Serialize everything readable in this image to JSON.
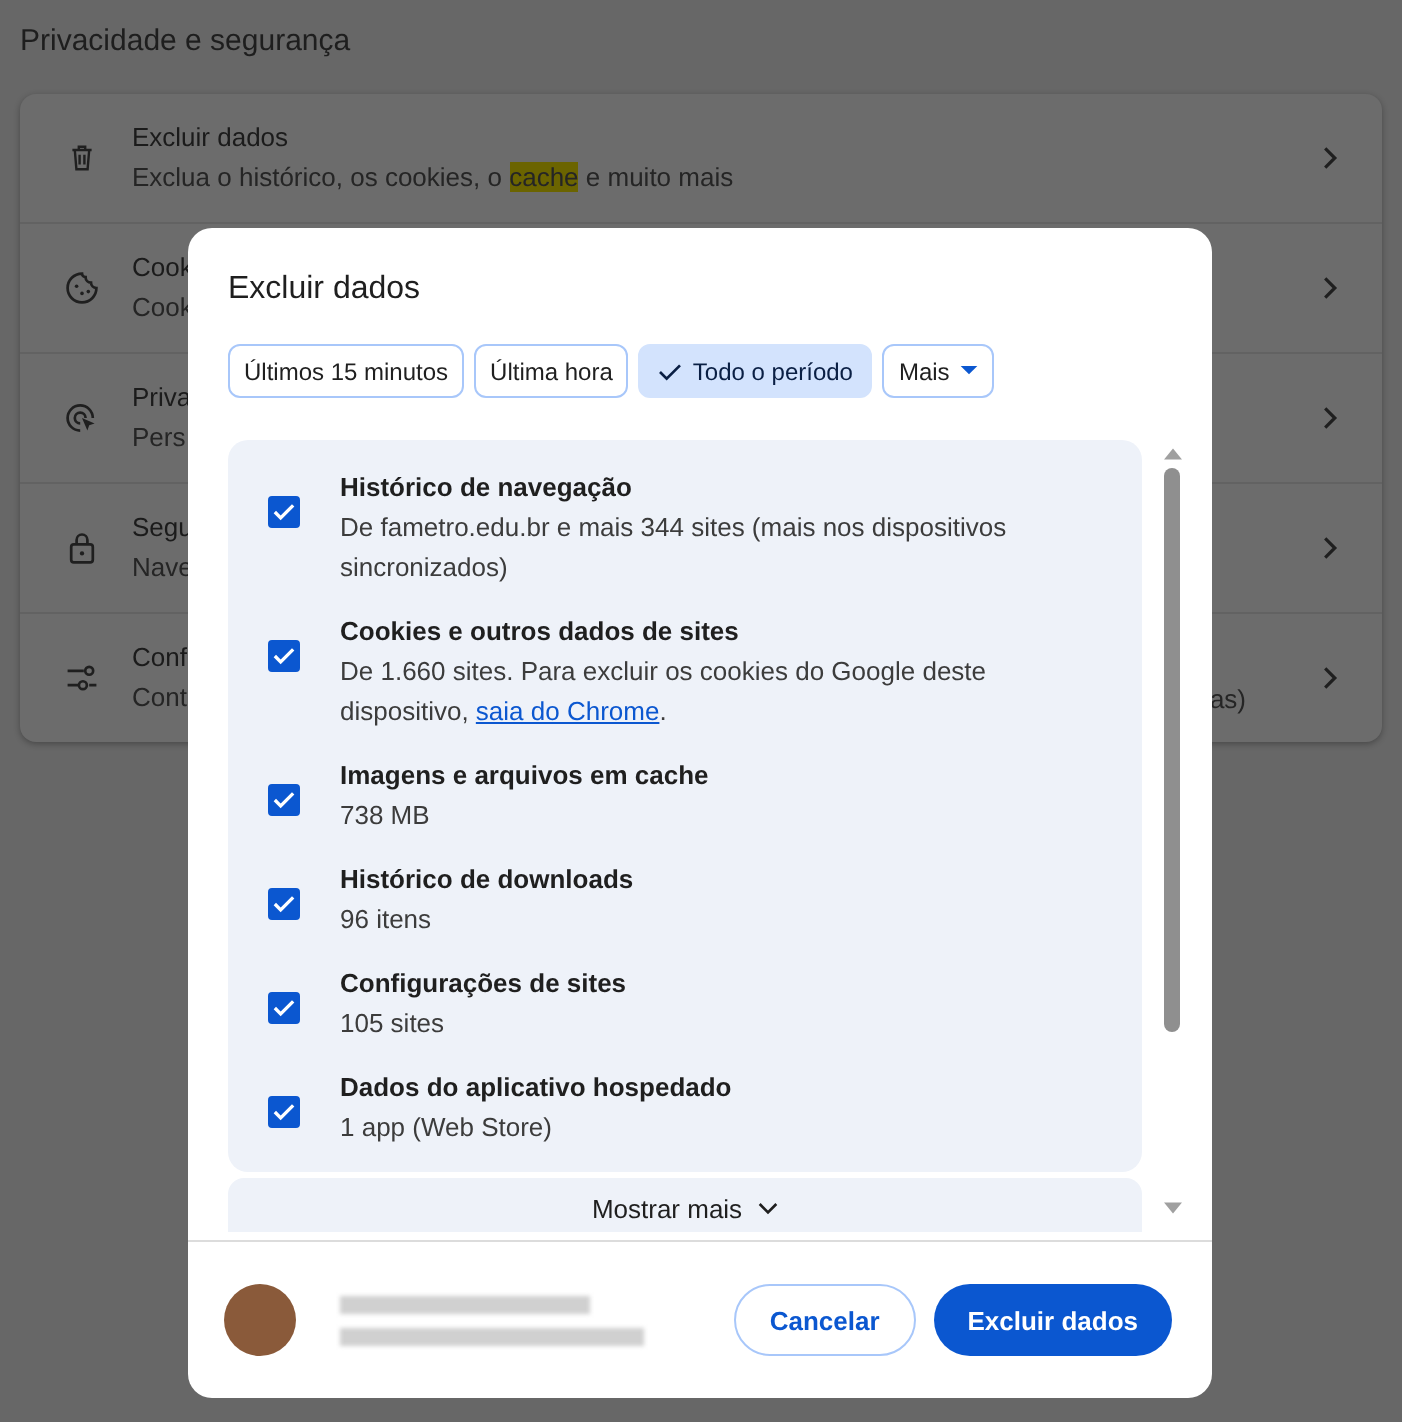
{
  "page": {
    "title": "Privacidade e segurança"
  },
  "settings_rows": [
    {
      "title": "Excluir dados",
      "subtitle": [
        {
          "text": "Exclua o histórico, os cookies, o ",
          "highlighted": false
        },
        {
          "text": "cache",
          "highlighted": true
        },
        {
          "text": " e muito mais",
          "highlighted": false
        }
      ]
    },
    {
      "title": "Cook",
      "subtitle": [
        {
          "text": "Cook",
          "highlighted": false
        }
      ]
    },
    {
      "title": "Priva",
      "subtitle": [
        {
          "text": "Pers",
          "highlighted": false
        }
      ]
    },
    {
      "title": "Segu",
      "subtitle": [
        {
          "text": "Nave",
          "highlighted": false
        }
      ]
    },
    {
      "title": "Conf",
      "subtitle": [
        {
          "text": "Cont",
          "highlighted": false
        }
      ],
      "trailing": "as)"
    }
  ],
  "dialog": {
    "title": "Excluir dados",
    "time_ranges": [
      {
        "label": "Últimos 15 minutos",
        "selected": false
      },
      {
        "label": "Última hora",
        "selected": false
      },
      {
        "label": "Todo o período",
        "selected": true
      }
    ],
    "more_dropdown": {
      "label": "Mais"
    },
    "items": [
      {
        "title": "Histórico de navegação",
        "description": "De fametro.edu.br e mais 344 sites (mais nos dispositivos sincronizados)",
        "checked": true
      },
      {
        "title": "Cookies e outros dados de sites",
        "description": "De 1.660 sites. Para excluir os cookies do Google deste dispositivo, ",
        "link": "saia do Chrome",
        "after_link": ".",
        "checked": true
      },
      {
        "title": "Imagens e arquivos em cache",
        "description": "738 MB",
        "checked": true
      },
      {
        "title": "Histórico de downloads",
        "description": "96 itens",
        "checked": true
      },
      {
        "title": "Configurações de sites",
        "description": "105 sites",
        "checked": true
      },
      {
        "title": "Dados do aplicativo hospedado",
        "description": "1 app (Web Store)",
        "checked": true
      }
    ],
    "show_more": "Mostrar mais",
    "buttons": [
      {
        "label": "Cancelar",
        "kind": "secondary"
      },
      {
        "label": "Excluir dados",
        "kind": "primary"
      }
    ]
  }
}
